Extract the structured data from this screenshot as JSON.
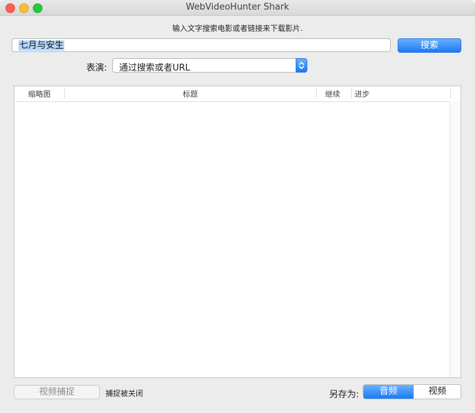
{
  "window": {
    "title": "WebVideoHunter Shark"
  },
  "search": {
    "prompt": "输入文字搜索电影或者链接来下载影片.",
    "value": "七月与安生",
    "button_label": "搜索"
  },
  "perform": {
    "label": "表演:",
    "selected": "通过搜索或者URL"
  },
  "table": {
    "columns": [
      "缩略图",
      "标题",
      "继续",
      "进步"
    ],
    "rows": []
  },
  "footer": {
    "capture_button": "视频捕捉",
    "capture_status": "捕捉被关闭",
    "save_as_label": "另存为:",
    "save_options": [
      "音频",
      "视频"
    ],
    "selected_option": "音频"
  },
  "colors": {
    "accent": "#1a7bf2",
    "close": "#fc5f57",
    "minimize": "#fdbc2e",
    "maximize": "#28c840"
  }
}
